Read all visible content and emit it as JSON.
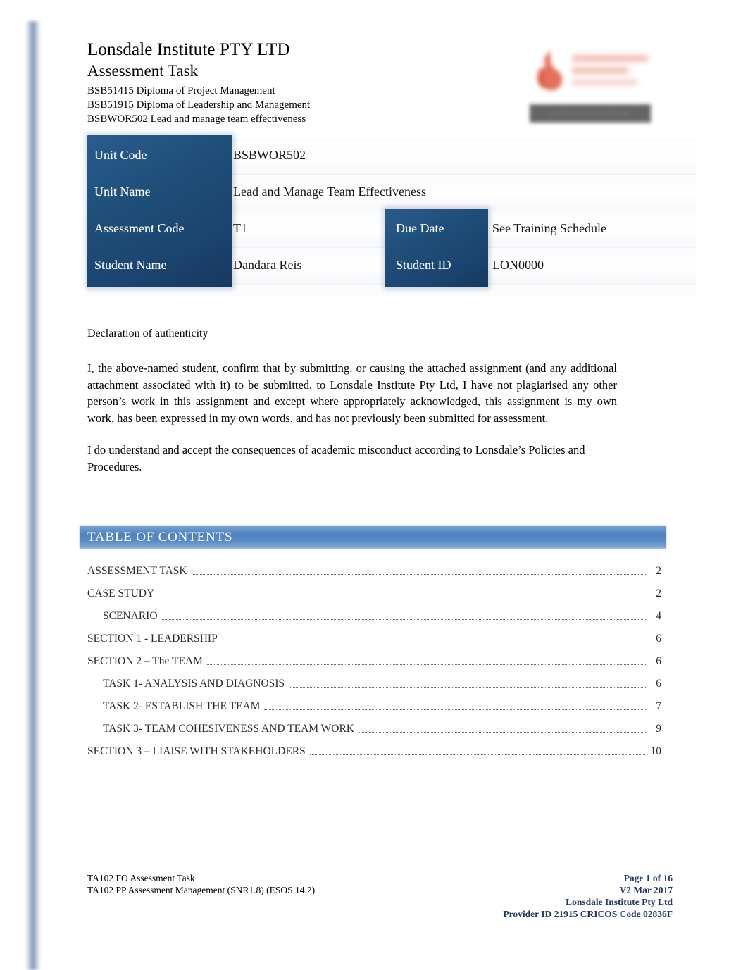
{
  "header": {
    "institute": "Lonsdale Institute PTY LTD",
    "doc_type": "Assessment Task",
    "qualification_1": "BSB51415 Diploma of Project Management",
    "qualification_2": "BSB51915 Diploma of Leadership and Management",
    "unit_line": "BSBWOR502 Lead and manage team effectiveness"
  },
  "logo": {
    "name": "lonsdale-institute-logo",
    "mark_color": "#e2654f",
    "band_text": "LONSDALE INSTITUTE"
  },
  "details_table": {
    "rows": [
      {
        "label": "Unit Code",
        "value": "BSBWOR502"
      },
      {
        "label": "Unit Name",
        "value": "Lead and Manage Team Effectiveness"
      },
      {
        "label": "Assessment Code",
        "value": "T1"
      },
      {
        "label": "Student Name",
        "value": "Dandara Reis"
      }
    ],
    "secondary": [
      {
        "label": "Due Date",
        "value": "See Training Schedule"
      },
      {
        "label": "Student ID",
        "value": "LON0000"
      }
    ],
    "header_color": "#1F4E79"
  },
  "declaration": {
    "heading": "Declaration of authenticity",
    "paragraph_1": "I, the above-named student, confirm that by submitting, or causing the attached assignment (and any additional attachment associated with it) to be submitted, to Lonsdale Institute Pty Ltd, I have not plagiarised any other person’s work in this assignment and except where appropriately acknowledged, this assignment is my own work, has been expressed in my own words, and has not previously been submitted for assessment.",
    "paragraph_2": "I do understand and accept the consequences of academic misconduct according to Lonsdale’s Policies and Procedures."
  },
  "toc": {
    "title": "TABLE OF CONTENTS",
    "bar_color": "#4E83C0",
    "entries": [
      {
        "label": "ASSESSMENT TASK",
        "page": "2",
        "level": 1
      },
      {
        "label": "CASE STUDY",
        "page": "2",
        "level": 1
      },
      {
        "label": "SCENARIO",
        "page": "4",
        "level": 2
      },
      {
        "label": "SECTION 1 - LEADERSHIP",
        "page": "6",
        "level": 1
      },
      {
        "label": "SECTION 2 – The TEAM",
        "page": "6",
        "level": 1
      },
      {
        "label": "TASK 1- ANALYSIS AND DIAGNOSIS",
        "page": "6",
        "level": 2
      },
      {
        "label": "TASK 2- ESTABLISH THE TEAM",
        "page": "7",
        "level": 2
      },
      {
        "label": "TASK 3- TEAM COHESIVENESS AND TEAM WORK",
        "page": "9",
        "level": 2
      },
      {
        "label": "SECTION 3 – LIAISE WITH STAKEHOLDERS",
        "page": "10",
        "level": 1
      }
    ]
  },
  "footer": {
    "left_line_1": "TA102 FO Assessment Task",
    "left_line_2": "TA102 PP Assessment Management (SNR1.8) (ESOS 14.2)",
    "right_line_1": "Page 1 of 16",
    "right_line_2": "V2 Mar 2017",
    "right_line_3": "Lonsdale Institute Pty Ltd",
    "right_line_4": "Provider ID 21915 CRICOS Code 02836F",
    "right_color": "#1F3864"
  }
}
